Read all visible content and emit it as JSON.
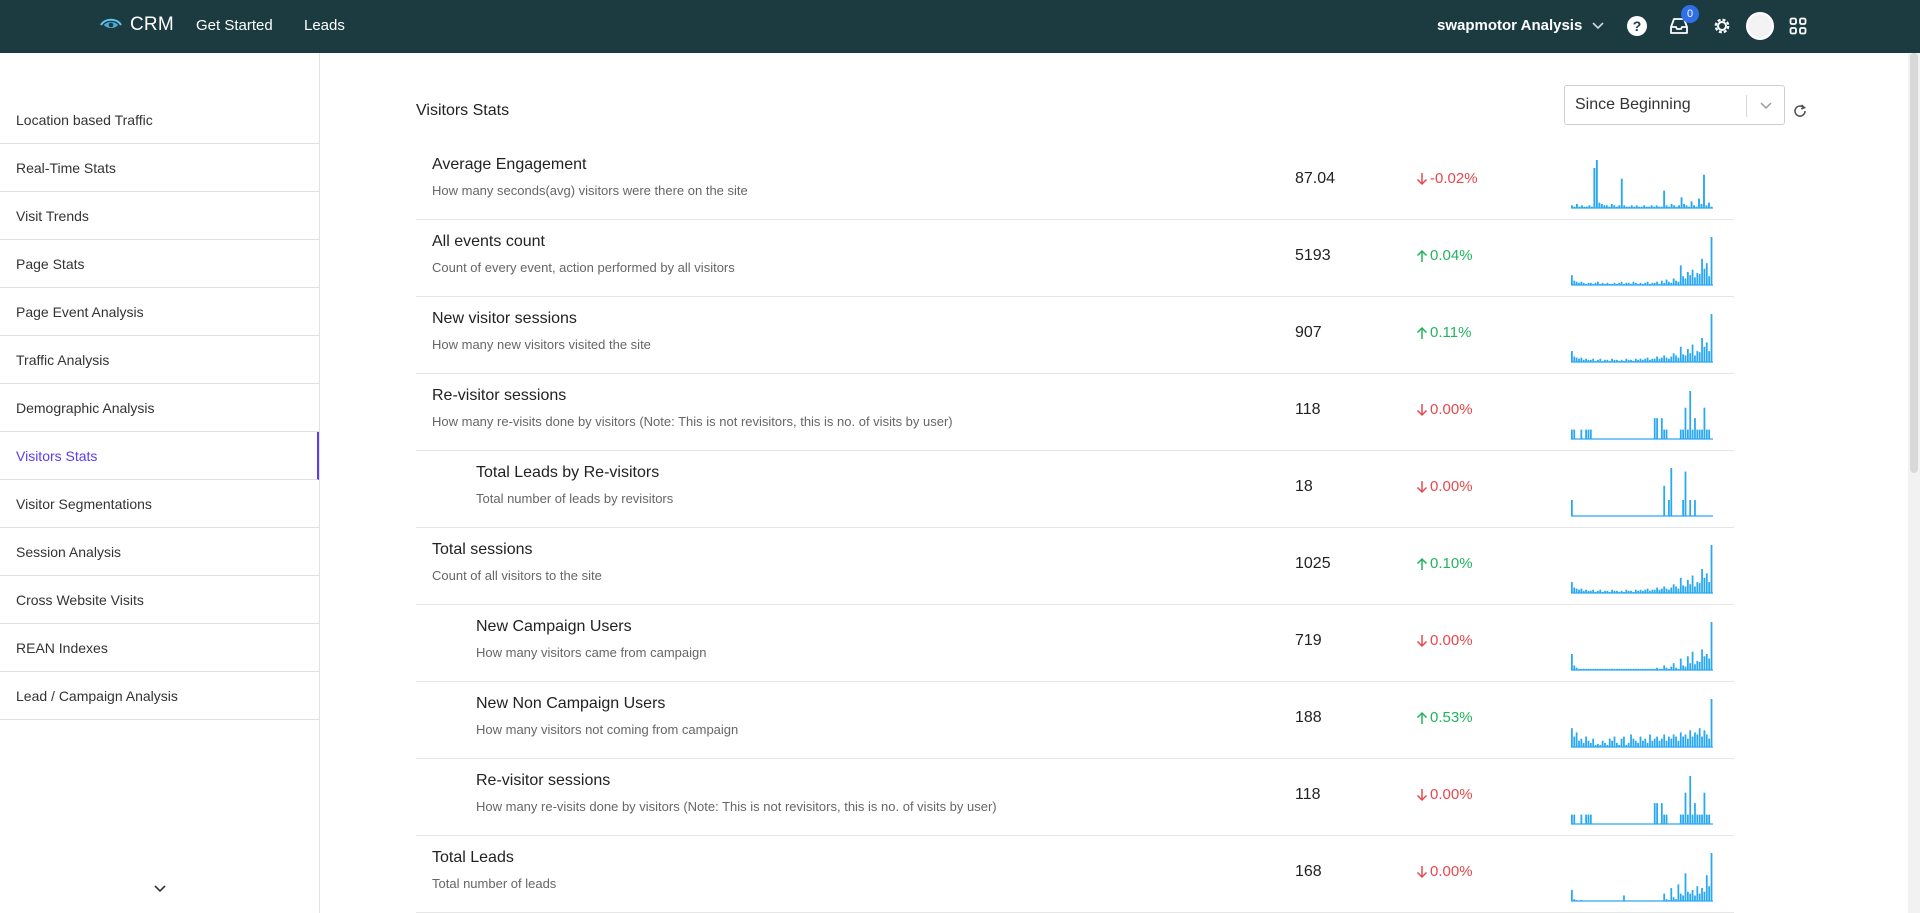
{
  "header": {
    "brand": "CRM",
    "nav": [
      {
        "label": "Get Started"
      },
      {
        "label": "Leads"
      }
    ],
    "account": "swapmotor Analysis",
    "inbox_count": "0"
  },
  "sidebar": {
    "items": [
      {
        "label": "Location based Traffic"
      },
      {
        "label": "Real-Time Stats"
      },
      {
        "label": "Visit Trends"
      },
      {
        "label": "Page Stats"
      },
      {
        "label": "Page Event Analysis"
      },
      {
        "label": "Traffic Analysis"
      },
      {
        "label": "Demographic Analysis"
      },
      {
        "label": "Visitors Stats"
      },
      {
        "label": "Visitor Segmentations"
      },
      {
        "label": "Session Analysis"
      },
      {
        "label": "Cross Website Visits"
      },
      {
        "label": "REAN Indexes"
      },
      {
        "label": "Lead / Campaign Analysis"
      }
    ],
    "active_index": 7
  },
  "main": {
    "title": "Visitors Stats",
    "range_select": "Since Beginning",
    "rows": [
      {
        "title": "Average Engagement",
        "desc": "How many seconds(avg) visitors were there on the site",
        "value": "87.04",
        "change": "-0.02%",
        "direction": "down",
        "indent": false,
        "spark": [
          2,
          1,
          3,
          1,
          2,
          1,
          1,
          2,
          1,
          30,
          36,
          4,
          3,
          2,
          2,
          1,
          3,
          2,
          1,
          2,
          22,
          2,
          1,
          1,
          2,
          1,
          2,
          1,
          1,
          2,
          1,
          1,
          2,
          1,
          2,
          1,
          1,
          13,
          2,
          1,
          3,
          2,
          1,
          2,
          8,
          3,
          2,
          1,
          5,
          2,
          1,
          7,
          3,
          25,
          2,
          4,
          1
        ]
      },
      {
        "title": "All events count",
        "desc": "Count of every event, action performed by all visitors",
        "value": "5193",
        "change": "0.04%",
        "direction": "up",
        "indent": false,
        "spark": [
          9,
          4,
          3,
          2,
          3,
          2,
          1,
          2,
          2,
          1,
          2,
          3,
          1,
          2,
          1,
          2,
          1,
          1,
          2,
          1,
          2,
          3,
          1,
          2,
          2,
          1,
          3,
          2,
          1,
          2,
          1,
          2,
          3,
          1,
          2,
          2,
          3,
          1,
          4,
          2,
          5,
          3,
          2,
          6,
          4,
          3,
          18,
          8,
          6,
          12,
          9,
          14,
          7,
          11,
          10,
          24,
          15,
          20,
          8,
          44
        ]
      },
      {
        "title": "New visitor sessions",
        "desc": "How many new visitors visited the site",
        "value": "907",
        "change": "0.11%",
        "direction": "up",
        "indent": false,
        "spark": [
          10,
          5,
          4,
          3,
          4,
          2,
          3,
          2,
          2,
          3,
          1,
          2,
          3,
          1,
          2,
          2,
          1,
          3,
          2,
          2,
          1,
          2,
          1,
          3,
          2,
          2,
          1,
          3,
          2,
          3,
          2,
          3,
          4,
          2,
          3,
          3,
          5,
          3,
          4,
          6,
          4,
          3,
          5,
          8,
          6,
          4,
          14,
          7,
          6,
          12,
          8,
          16,
          6,
          10,
          9,
          22,
          14,
          18,
          10,
          44
        ]
      },
      {
        "title": "Re-visitor sessions",
        "desc": "How many re-visits done by visitors (Note: This is not revisitors, this is no. of visits by user)",
        "value": "118",
        "change": "0.00%",
        "direction": "down",
        "indent": false,
        "spark": [
          9,
          9,
          0,
          0,
          9,
          0,
          9,
          9,
          9,
          0,
          0,
          0,
          0,
          0,
          0,
          0,
          0,
          0,
          0,
          0,
          0,
          0,
          0,
          0,
          0,
          0,
          0,
          0,
          0,
          0,
          0,
          0,
          0,
          0,
          0,
          20,
          20,
          0,
          20,
          9,
          9,
          0,
          0,
          0,
          0,
          0,
          9,
          9,
          30,
          9,
          46,
          9,
          20,
          9,
          9,
          9,
          30,
          9,
          9,
          0
        ]
      },
      {
        "title": "Total Leads by Re-visitors",
        "desc": "Total number of leads by revisitors",
        "value": "18",
        "change": "0.00%",
        "direction": "down",
        "indent": true,
        "spark": [
          18,
          0,
          0,
          0,
          0,
          0,
          0,
          0,
          0,
          0,
          0,
          0,
          0,
          0,
          0,
          0,
          0,
          0,
          0,
          0,
          0,
          0,
          0,
          0,
          0,
          0,
          0,
          0,
          0,
          0,
          0,
          0,
          0,
          0,
          0,
          0,
          0,
          0,
          0,
          34,
          0,
          18,
          54,
          0,
          0,
          0,
          0,
          18,
          50,
          0,
          18,
          0,
          18,
          0,
          0,
          0,
          0,
          0,
          0,
          0
        ]
      },
      {
        "title": "Total sessions",
        "desc": "Count of all visitors to the site",
        "value": "1025",
        "change": "0.10%",
        "direction": "up",
        "indent": false,
        "spark": [
          10,
          5,
          4,
          3,
          4,
          2,
          3,
          2,
          2,
          3,
          1,
          2,
          3,
          1,
          2,
          2,
          1,
          3,
          2,
          2,
          1,
          2,
          1,
          3,
          2,
          2,
          1,
          3,
          2,
          3,
          2,
          3,
          4,
          2,
          3,
          3,
          5,
          3,
          4,
          6,
          4,
          3,
          5,
          8,
          6,
          4,
          14,
          7,
          6,
          12,
          8,
          16,
          6,
          10,
          9,
          22,
          14,
          18,
          10,
          44
        ]
      },
      {
        "title": "New Campaign Users",
        "desc": "How many visitors came from campaign",
        "value": "719",
        "change": "0.00%",
        "direction": "down",
        "indent": true,
        "spark": [
          14,
          4,
          2,
          1,
          1,
          1,
          1,
          1,
          1,
          1,
          1,
          1,
          1,
          1,
          1,
          1,
          1,
          1,
          1,
          1,
          1,
          1,
          1,
          1,
          1,
          1,
          1,
          1,
          1,
          1,
          1,
          1,
          1,
          1,
          1,
          1,
          2,
          1,
          1,
          4,
          2,
          1,
          3,
          6,
          2,
          1,
          10,
          4,
          3,
          12,
          6,
          16,
          5,
          8,
          7,
          18,
          12,
          14,
          10,
          42
        ]
      },
      {
        "title": "New Non Campaign Users",
        "desc": "How many visitors not coming from campaign",
        "value": "188",
        "change": "0.53%",
        "direction": "up",
        "indent": true,
        "spark": [
          18,
          10,
          14,
          6,
          8,
          4,
          10,
          6,
          4,
          8,
          2,
          3,
          2,
          6,
          4,
          2,
          8,
          6,
          10,
          4,
          2,
          8,
          10,
          2,
          4,
          12,
          8,
          6,
          4,
          10,
          6,
          8,
          4,
          12,
          6,
          8,
          10,
          6,
          8,
          12,
          6,
          10,
          8,
          12,
          10,
          6,
          14,
          10,
          12,
          8,
          16,
          10,
          14,
          12,
          18,
          10,
          16,
          12,
          8,
          46
        ]
      },
      {
        "title": "Re-visitor sessions",
        "desc": "How many re-visits done by visitors (Note: This is not revisitors, this is no. of visits by user)",
        "value": "118",
        "change": "0.00%",
        "direction": "down",
        "indent": true,
        "spark": [
          9,
          9,
          0,
          0,
          9,
          0,
          9,
          9,
          9,
          0,
          0,
          0,
          0,
          0,
          0,
          0,
          0,
          0,
          0,
          0,
          0,
          0,
          0,
          0,
          0,
          0,
          0,
          0,
          0,
          0,
          0,
          0,
          0,
          0,
          0,
          20,
          20,
          0,
          20,
          9,
          9,
          0,
          0,
          0,
          0,
          0,
          9,
          9,
          30,
          9,
          46,
          9,
          20,
          9,
          9,
          9,
          30,
          9,
          9,
          0
        ]
      },
      {
        "title": "Total Leads",
        "desc": "Total number of leads",
        "value": "168",
        "change": "0.00%",
        "direction": "down",
        "indent": false,
        "spark": [
          12,
          2,
          1,
          0,
          1,
          0,
          0,
          0,
          0,
          0,
          0,
          0,
          0,
          0,
          0,
          0,
          0,
          0,
          0,
          0,
          0,
          0,
          6,
          0,
          0,
          0,
          0,
          0,
          0,
          0,
          0,
          0,
          0,
          0,
          0,
          0,
          0,
          0,
          0,
          8,
          2,
          1,
          14,
          4,
          2,
          18,
          8,
          6,
          30,
          10,
          8,
          12,
          6,
          16,
          8,
          14,
          10,
          28,
          16,
          52
        ]
      }
    ]
  },
  "colors": {
    "topbar": "#1b3b40",
    "accent": "#5b3df0",
    "spark": "#29a8f2",
    "down": "#e5484d",
    "up": "#22b35e"
  }
}
